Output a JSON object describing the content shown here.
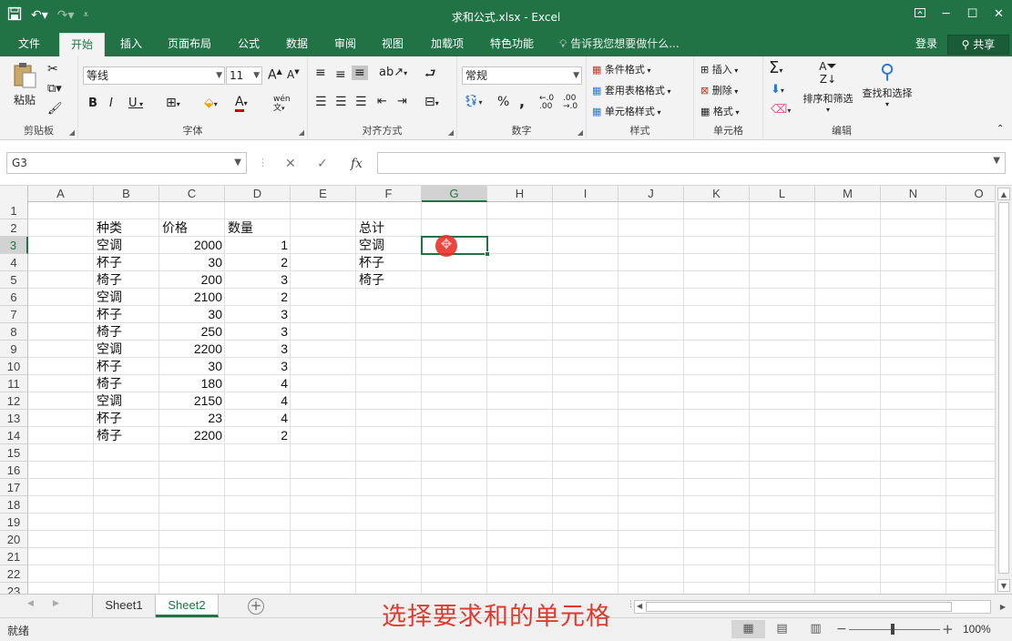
{
  "window": {
    "title": "求和公式.xlsx - Excel",
    "save_icon": "save-icon",
    "undo_icon": "undo-icon",
    "redo_icon": "redo-icon",
    "customize_icon": "customize-qat-icon",
    "ribbon_options_icon": "ribbon-display-options-icon",
    "minimize": "─",
    "maximize": "☐",
    "close": "✕"
  },
  "tabs": {
    "items": [
      {
        "label": "文件"
      },
      {
        "label": "开始"
      },
      {
        "label": "插入"
      },
      {
        "label": "页面布局"
      },
      {
        "label": "公式"
      },
      {
        "label": "数据"
      },
      {
        "label": "审阅"
      },
      {
        "label": "视图"
      },
      {
        "label": "加载项"
      },
      {
        "label": "特色功能"
      }
    ],
    "active": "开始",
    "tell_me": "告诉我您想要做什么...",
    "login": "登录",
    "share": "共享"
  },
  "ribbon": {
    "clipboard": {
      "label": "剪贴板",
      "paste": "粘贴"
    },
    "font": {
      "label": "字体",
      "font_name": "等线",
      "font_size": "11",
      "bold": "B",
      "italic": "I",
      "underline": "U",
      "grow": "A",
      "shrink": "A",
      "font_color_letter": "A",
      "phonetic": "wén"
    },
    "alignment": {
      "label": "对齐方式"
    },
    "number": {
      "label": "数字",
      "format": "常规",
      "percent": "%",
      "comma": ","
    },
    "styles": {
      "label": "样式",
      "conditional": "条件格式",
      "table": "套用表格格式",
      "cell_styles": "单元格样式"
    },
    "cells": {
      "label": "单元格",
      "insert": "插入",
      "delete": "删除",
      "format": "格式"
    },
    "editing": {
      "label": "编辑",
      "sort_filter": "排序和筛选",
      "find_select": "查找和选择"
    }
  },
  "formula_bar": {
    "name_box": "G3",
    "cancel": "✕",
    "enter": "✓",
    "fx": "fx",
    "formula": ""
  },
  "grid": {
    "columns": [
      "A",
      "B",
      "C",
      "D",
      "E",
      "F",
      "G",
      "H",
      "I",
      "J",
      "K",
      "L",
      "M",
      "N",
      "O"
    ],
    "rows": [
      "1",
      "2",
      "3",
      "4",
      "5",
      "6",
      "7",
      "8",
      "9",
      "10",
      "11",
      "12",
      "13",
      "14",
      "15",
      "16",
      "17",
      "18",
      "19",
      "20",
      "21",
      "22",
      "23"
    ],
    "selected_cell": "G3",
    "headers": {
      "B": "种类",
      "C": "价格",
      "D": "数量",
      "F": "总计"
    },
    "table": [
      {
        "type": "空调",
        "price": "2000",
        "qty": "1"
      },
      {
        "type": "杯子",
        "price": "30",
        "qty": "2"
      },
      {
        "type": "椅子",
        "price": "200",
        "qty": "3"
      },
      {
        "type": "空调",
        "price": "2100",
        "qty": "2"
      },
      {
        "type": "杯子",
        "price": "30",
        "qty": "3"
      },
      {
        "type": "椅子",
        "price": "250",
        "qty": "3"
      },
      {
        "type": "空调",
        "price": "2200",
        "qty": "3"
      },
      {
        "type": "杯子",
        "price": "30",
        "qty": "3"
      },
      {
        "type": "椅子",
        "price": "180",
        "qty": "4"
      },
      {
        "type": "空调",
        "price": "2150",
        "qty": "4"
      },
      {
        "type": "杯子",
        "price": "23",
        "qty": "4"
      },
      {
        "type": "椅子",
        "price": "2200",
        "qty": "2"
      }
    ],
    "summary": [
      "空调",
      "杯子",
      "椅子"
    ]
  },
  "sheets": {
    "tabs": [
      "Sheet1",
      "Sheet2"
    ],
    "active": "Sheet2"
  },
  "status": {
    "ready": "就绪",
    "zoom": "100%",
    "zoom_out": "−",
    "zoom_in": "+"
  },
  "caption": "选择要求和的单元格",
  "colors": {
    "brand": "#217346",
    "caption": "#e03a2e",
    "cursor": "#e8322b"
  }
}
